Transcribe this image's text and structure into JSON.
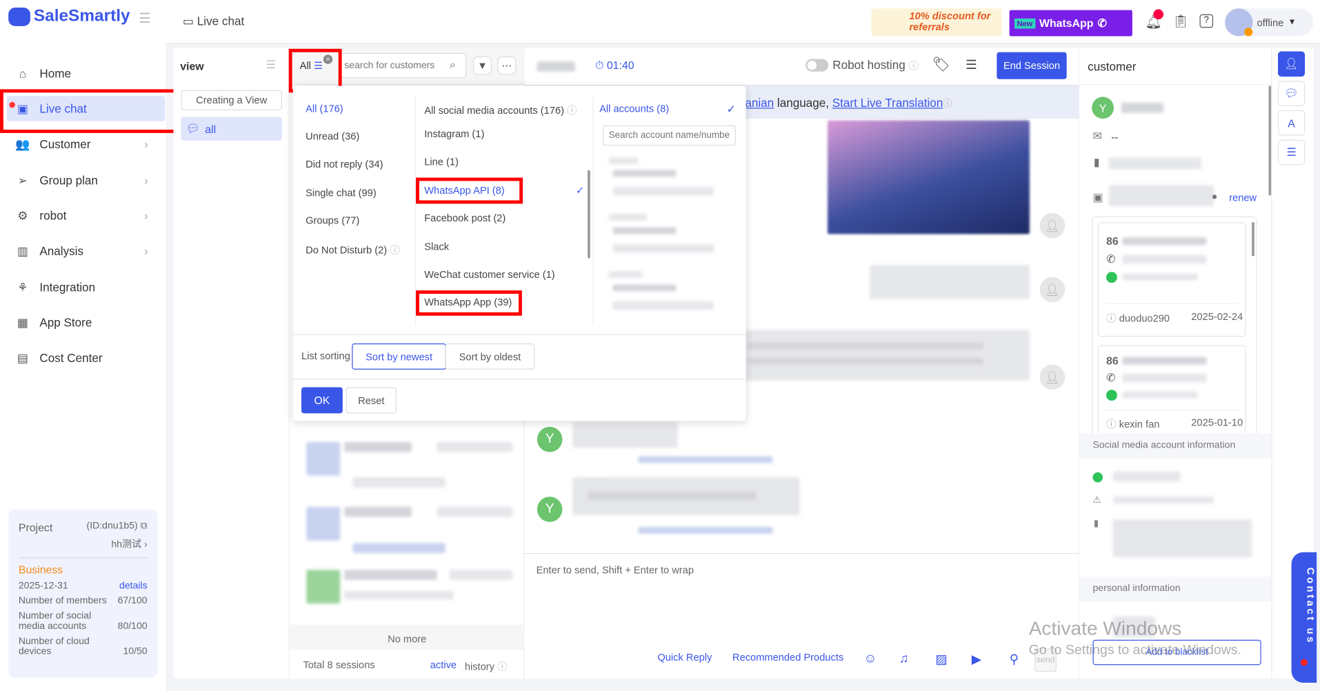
{
  "app": {
    "brand": "SaleSmartly",
    "page_title": "Live chat"
  },
  "topbar": {
    "promo_referral": "10% discount for referrals",
    "promo_whatsapp_badge": "New",
    "promo_whatsapp": "WhatsApp",
    "status": "offline"
  },
  "sidebar": {
    "items": [
      {
        "label": "Home"
      },
      {
        "label": "Live chat"
      },
      {
        "label": "Customer"
      },
      {
        "label": "Group plan"
      },
      {
        "label": "robot"
      },
      {
        "label": "Analysis"
      },
      {
        "label": "Integration"
      },
      {
        "label": "App Store"
      },
      {
        "label": "Cost Center"
      }
    ],
    "project": {
      "label": "Project",
      "id": "(ID:dnu1b5)",
      "name": "hh测试",
      "plan": "Business",
      "expiry": "2025-12-31",
      "details": "details",
      "stats": [
        {
          "label": "Number of members",
          "value": "67/100"
        },
        {
          "label": "Number of social media accounts",
          "value": "80/100"
        },
        {
          "label": "Number of cloud devices",
          "value": "10/50"
        }
      ]
    }
  },
  "views": {
    "title": "view",
    "create": "Creating a View",
    "items": [
      {
        "label": "all"
      }
    ]
  },
  "sessions": {
    "filter_label": "All",
    "search_placeholder": "search for customers",
    "no_more": "No more",
    "total": "Total 8 sessions",
    "active": "active",
    "history": "history"
  },
  "dropdown": {
    "status": [
      "All (176)",
      "Unread (36)",
      "Did not reply (34)",
      "Single chat (99)",
      "Groups (77)",
      "Do Not Disturb (2)"
    ],
    "channels": [
      "All social media accounts (176)",
      "Instagram (1)",
      "Line (1)",
      "WhatsApp API (8)",
      "Facebook post (2)",
      "Slack",
      "WeChat customer service (1)",
      "WhatsApp App (39)"
    ],
    "accounts_label": "All accounts (8)",
    "account_search_placeholder": "Search account name/number",
    "sort_label": "List sorting",
    "sort_newest": "Sort by newest",
    "sort_oldest": "Sort by oldest",
    "ok": "OK",
    "reset": "Reset"
  },
  "chat": {
    "timer": "01:40",
    "robot_hosting": "Robot hosting",
    "end_session": "End Session",
    "translate_lang": "anian",
    "translate_mid": " language, ",
    "translate_link": "Start Live Translation",
    "input_placeholder": "Enter to send, Shift + Enter to wrap",
    "quick_reply": "Quick Reply",
    "recommended": "Recommended Products",
    "send": "send",
    "avatar_letter": "Y"
  },
  "customer": {
    "title": "customer",
    "avatar_letter": "Y",
    "email": "--",
    "renew": "renew",
    "cards": [
      {
        "prefix": "86",
        "owner": "duoduo290",
        "date": "2025-02-24"
      },
      {
        "prefix": "86",
        "owner": "kexin fan",
        "date": "2025-01-10"
      }
    ],
    "social_section": "Social media account information",
    "personal_section": "personal information",
    "blacklist": "Add to blacklist"
  },
  "contact_us": "Contact us",
  "watermark": {
    "line1": "Activate Windows",
    "line2": "Go to Settings to activate Windows."
  }
}
